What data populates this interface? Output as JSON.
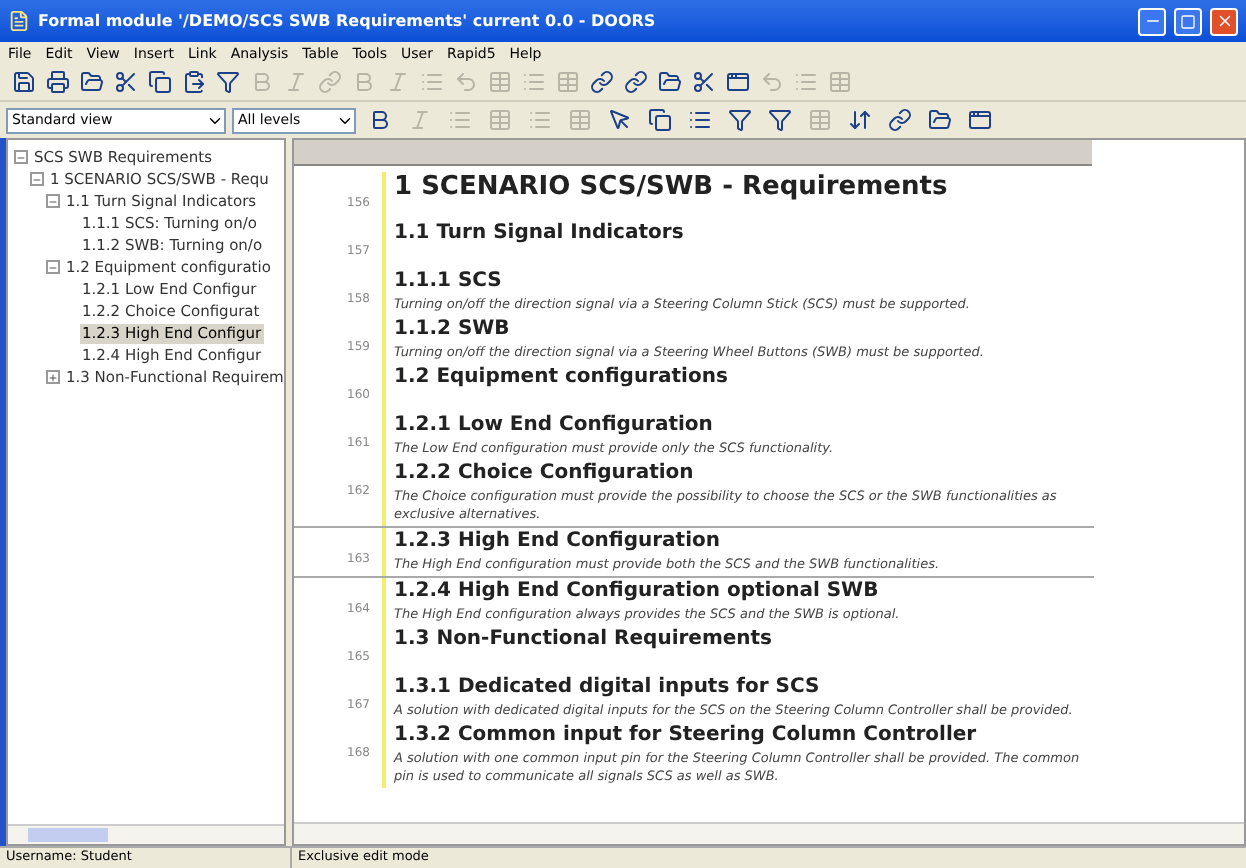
{
  "window": {
    "title": "Formal module '/DEMO/SCS SWB Requirements' current 0.0 - DOORS"
  },
  "menu": [
    "File",
    "Edit",
    "View",
    "Insert",
    "Link",
    "Analysis",
    "Table",
    "Tools",
    "User",
    "Rapid5",
    "Help"
  ],
  "toolbar_1": [
    {
      "kind": "save",
      "disabled": false
    },
    {
      "kind": "print",
      "disabled": false
    },
    {
      "kind": "folder",
      "disabled": false
    },
    {
      "kind": "cut",
      "disabled": false
    },
    {
      "kind": "copy",
      "disabled": false
    },
    {
      "kind": "paste",
      "disabled": false
    },
    {
      "kind": "filter",
      "disabled": false
    },
    {
      "kind": "bold",
      "disabled": true
    },
    {
      "kind": "italic",
      "disabled": true
    },
    {
      "kind": "link",
      "disabled": true
    },
    {
      "kind": "bold",
      "disabled": true
    },
    {
      "kind": "italic",
      "disabled": true
    },
    {
      "kind": "list",
      "disabled": true
    },
    {
      "kind": "undo",
      "disabled": true
    },
    {
      "kind": "table",
      "disabled": true
    },
    {
      "kind": "list",
      "disabled": true
    },
    {
      "kind": "table",
      "disabled": true
    },
    {
      "kind": "link",
      "disabled": false
    },
    {
      "kind": "link",
      "disabled": false
    },
    {
      "kind": "folder",
      "disabled": false
    },
    {
      "kind": "cut",
      "disabled": false
    },
    {
      "kind": "window",
      "disabled": false
    },
    {
      "kind": "undo",
      "disabled": true
    },
    {
      "kind": "list",
      "disabled": true
    },
    {
      "kind": "table",
      "disabled": true
    }
  ],
  "view_select": {
    "value": "Standard view"
  },
  "level_select": {
    "value": "All levels"
  },
  "toolbar_2": [
    {
      "kind": "bold",
      "disabled": false
    },
    {
      "kind": "italic",
      "disabled": true
    },
    {
      "kind": "list",
      "disabled": true
    },
    {
      "kind": "table",
      "disabled": true
    },
    {
      "kind": "list",
      "disabled": true
    },
    {
      "kind": "table",
      "disabled": true
    },
    {
      "kind": "cursor",
      "disabled": false
    },
    {
      "kind": "copy",
      "disabled": false
    },
    {
      "kind": "list",
      "disabled": false
    },
    {
      "kind": "filter",
      "disabled": false
    },
    {
      "kind": "filter",
      "disabled": false
    },
    {
      "kind": "table",
      "disabled": true
    },
    {
      "kind": "sort",
      "disabled": false
    },
    {
      "kind": "link",
      "disabled": false
    },
    {
      "kind": "folder",
      "disabled": false
    },
    {
      "kind": "window",
      "disabled": false
    }
  ],
  "tree": [
    {
      "label": "SCS SWB Requirements",
      "expanded": true,
      "selected": false,
      "children": [
        {
          "label": "1 SCENARIO SCS/SWB - Requ",
          "expanded": true,
          "selected": false,
          "children": [
            {
              "label": "1.1 Turn Signal Indicators",
              "expanded": true,
              "selected": false,
              "children": [
                {
                  "label": "1.1.1 SCS: Turning on/o",
                  "selected": false
                },
                {
                  "label": "1.1.2 SWB: Turning on/o",
                  "selected": false
                }
              ]
            },
            {
              "label": "1.2 Equipment configuratio",
              "expanded": true,
              "selected": false,
              "children": [
                {
                  "label": "1.2.1 Low End Configur",
                  "selected": false
                },
                {
                  "label": "1.2.2 Choice Configurat",
                  "selected": false
                },
                {
                  "label": "1.2.3 High End Configur",
                  "selected": true
                },
                {
                  "label": "1.2.4 High End Configur",
                  "selected": false
                }
              ]
            },
            {
              "label": "1.3 Non-Functional Requirem",
              "expanded": false,
              "selected": false
            }
          ]
        }
      ]
    }
  ],
  "document": [
    {
      "line": "156",
      "kind": "title",
      "heading": "1 SCENARIO SCS/SWB - Requirements"
    },
    {
      "line": "157",
      "kind": "heading",
      "heading": "1.1 Turn Signal Indicators"
    },
    {
      "line": "158",
      "kind": "heading",
      "heading": "1.1.1 SCS",
      "text": "Turning on/off the direction signal via a Steering Column Stick (SCS) must be supported."
    },
    {
      "line": "159",
      "kind": "heading",
      "heading": "1.1.2 SWB",
      "text": "Turning on/off the direction signal via a Steering Wheel Buttons (SWB) must be supported."
    },
    {
      "line": "160",
      "kind": "heading",
      "heading": "1.2 Equipment configurations"
    },
    {
      "line": "161",
      "kind": "heading",
      "heading": "1.2.1 Low End Configuration",
      "text": "The Low End configuration must provide only the SCS functionality."
    },
    {
      "line": "162",
      "kind": "heading",
      "heading": "1.2.2 Choice Configuration",
      "text": "The Choice configuration must provide the possibility to choose the SCS or the SWB functionalities as exclusive alternatives."
    },
    {
      "line": "163",
      "kind": "heading",
      "heading": "1.2.3 High End Configuration",
      "text": "The High End configuration must provide both the SCS and the SWB functionalities."
    },
    {
      "line": "164",
      "kind": "heading",
      "heading": "1.2.4 High End Configuration optional SWB",
      "text": "The High End configuration always provides the SCS and the SWB is optional."
    },
    {
      "line": "165",
      "kind": "heading",
      "heading": "1.3 Non-Functional Requirements"
    },
    {
      "line": "167",
      "kind": "heading",
      "heading": "1.3.1 Dedicated digital inputs for SCS",
      "text": "A solution with dedicated digital inputs for the SCS on the Steering Column Controller shall be provided."
    },
    {
      "line": "168",
      "kind": "heading",
      "heading": "1.3.2 Common input for Steering Column Controller",
      "text": "A solution with one common input pin for the Steering Column Controller shall be provided. The common pin is used to communicate all signals SCS as well as SWB."
    }
  ],
  "status_bar": [
    "Username: Student",
    "Exclusive edit mode"
  ]
}
